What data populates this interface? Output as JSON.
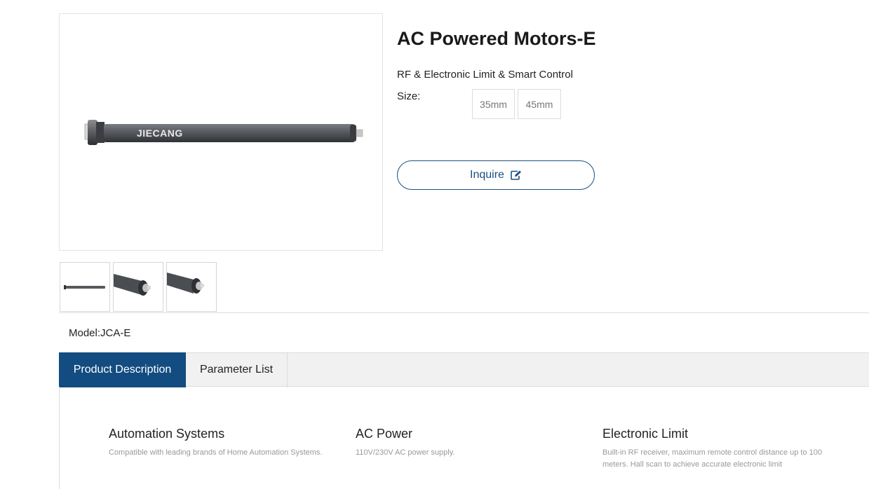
{
  "product": {
    "title": "AC Powered Motors-E",
    "subtitle": "RF & Electronic Limit & Smart Control",
    "brand_on_image": "JIECANG",
    "size_label": "Size:",
    "sizes": [
      "35mm",
      "45mm"
    ],
    "inquire_label": "Inquire",
    "model": "Model:JCA-E"
  },
  "tabs": [
    {
      "label": "Product Description",
      "active": true
    },
    {
      "label": "Parameter List",
      "active": false
    }
  ],
  "features": [
    {
      "title": "Automation Systems",
      "text": "Compatible with leading brands of Home Automation Systems."
    },
    {
      "title": "AC Power",
      "text": "110V/230V AC power supply."
    },
    {
      "title": "Electronic Limit",
      "text": "Built-in RF receiver, maximum remote control distance up to 100 meters. Hall scan to achieve accurate electronic limit"
    }
  ],
  "colors": {
    "accent": "#134c80",
    "motor_body": "#5a5d63"
  },
  "icons": {
    "inquire": "edit-icon"
  }
}
